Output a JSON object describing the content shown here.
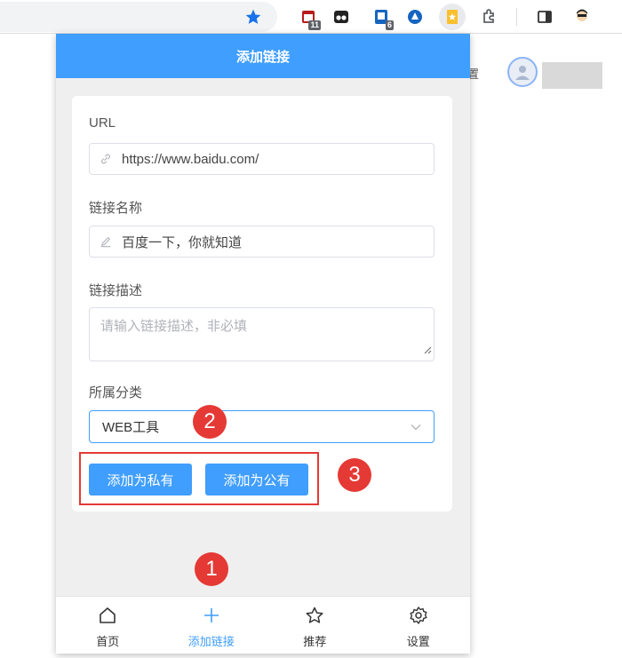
{
  "toolbar": {
    "extensions": [
      {
        "name": "calendar-extension",
        "badge": "11"
      },
      {
        "name": "tampermonkey-extension",
        "badge": ""
      },
      {
        "name": "tab-extension",
        "badge": "6"
      },
      {
        "name": "navigation-extension",
        "badge": ""
      },
      {
        "name": "bookmark-extension",
        "badge": ""
      }
    ]
  },
  "background": {
    "partial_text": "置"
  },
  "popup": {
    "title": "添加链接",
    "url_label": "URL",
    "url_value": "https://www.baidu.com/",
    "name_label": "链接名称",
    "name_value": "百度一下，你就知道",
    "desc_label": "链接描述",
    "desc_placeholder": "请输入链接描述，非必填",
    "category_label": "所属分类",
    "category_value": "WEB工具",
    "add_private_label": "添加为私有",
    "add_public_label": "添加为公有"
  },
  "nav": {
    "items": [
      {
        "label": "首页",
        "icon": "home-icon",
        "active": false
      },
      {
        "label": "添加链接",
        "icon": "plus-icon",
        "active": true
      },
      {
        "label": "推荐",
        "icon": "star-icon",
        "active": false
      },
      {
        "label": "设置",
        "icon": "gear-icon",
        "active": false
      }
    ]
  },
  "markers": [
    "1",
    "2",
    "3"
  ],
  "colors": {
    "primary": "#409eff",
    "marker": "#e53935",
    "chrome_blue": "#1a73e8"
  }
}
